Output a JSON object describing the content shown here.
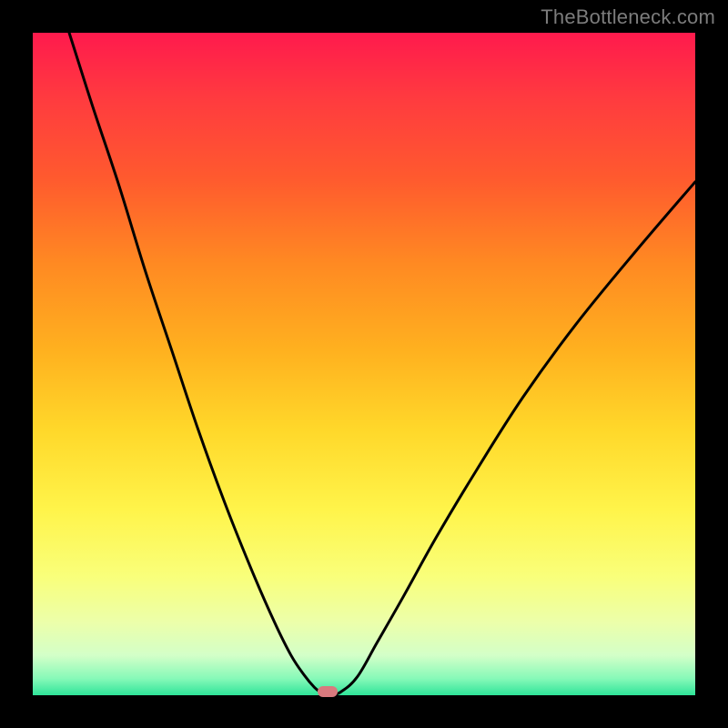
{
  "watermark": "TheBottleneck.com",
  "chart_data": {
    "type": "line",
    "title": "",
    "xlabel": "",
    "ylabel": "",
    "xlim": [
      0,
      1
    ],
    "ylim": [
      0,
      1
    ],
    "series": [
      {
        "name": "bottleneck-curve",
        "x": [
          0.055,
          0.09,
          0.13,
          0.17,
          0.21,
          0.25,
          0.29,
          0.33,
          0.365,
          0.39,
          0.41,
          0.425,
          0.435,
          0.44,
          0.45,
          0.465,
          0.49,
          0.52,
          0.56,
          0.61,
          0.67,
          0.74,
          0.82,
          0.91,
          1.0
        ],
        "y": [
          1.0,
          0.89,
          0.77,
          0.64,
          0.52,
          0.4,
          0.29,
          0.19,
          0.11,
          0.06,
          0.03,
          0.012,
          0.004,
          0.0,
          0.0,
          0.005,
          0.028,
          0.08,
          0.15,
          0.24,
          0.34,
          0.45,
          0.56,
          0.67,
          0.775
        ]
      }
    ],
    "marker": {
      "x": 0.445,
      "y": 0.0,
      "color": "#d87a7e"
    },
    "background_gradient": {
      "top": "#ff1a4d",
      "mid": "#ffd82a",
      "bottom": "#2fe499"
    }
  }
}
